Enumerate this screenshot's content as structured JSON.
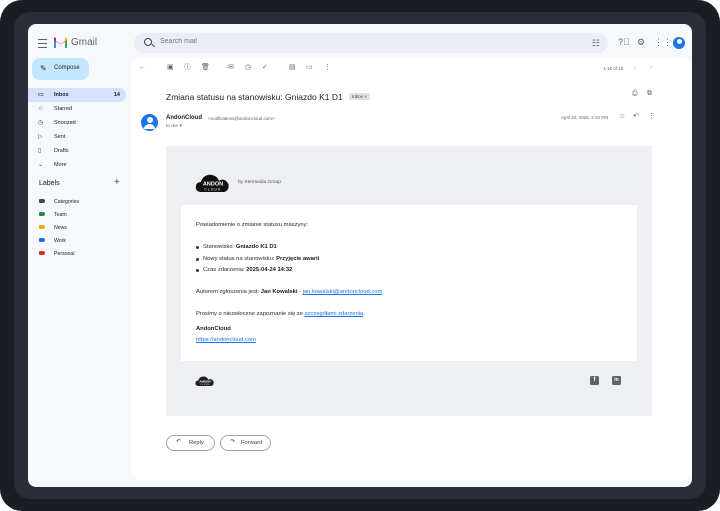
{
  "app": {
    "name": "Gmail"
  },
  "search": {
    "placeholder": "Search mail"
  },
  "compose": {
    "label": "Compose"
  },
  "nav": [
    {
      "label": "Inbox",
      "icon": "inbox-icon",
      "count": "14",
      "active": true
    },
    {
      "label": "Starred",
      "icon": "star-icon",
      "count": ""
    },
    {
      "label": "Snoozed",
      "icon": "clock-icon",
      "count": ""
    },
    {
      "label": "Sent",
      "icon": "send-icon",
      "count": ""
    },
    {
      "label": "Drafts",
      "icon": "draft-icon",
      "count": ""
    },
    {
      "label": "More",
      "icon": "chevron-down-icon",
      "count": ""
    }
  ],
  "labels": {
    "title": "Labels",
    "items": [
      {
        "name": "Categories",
        "color": "#444746"
      },
      {
        "name": "Team",
        "color": "#1e8e3e"
      },
      {
        "name": "News",
        "color": "#f9ab00"
      },
      {
        "name": "Work",
        "color": "#1a73e8"
      },
      {
        "name": "Personal",
        "color": "#d93025"
      }
    ]
  },
  "toolbar": {
    "page_count": "1-16 of 16"
  },
  "email": {
    "subject": "Zmiana statusu na stanowisku: Gniazdo K1 D1",
    "chip": "Inbox ×",
    "sender_name": "AndonCloud",
    "sender_email": "<notifications@andoncloud.com>",
    "to": "to me ▾",
    "date": "April 24, 2025, 2:32 PM",
    "brand": {
      "logo_top": "ANDON",
      "logo_bottom": "CLOUD",
      "by_line": "by Stermedia Group"
    },
    "body": {
      "intro": "Powiadomienie o zmianie statusu maszyny:",
      "b1_label": "Stanowisko: ",
      "b1_value": "Gniazdo K1 D1",
      "b2_label": "Nowy status na stanowisku: ",
      "b2_value": "Przyjęcie awarii",
      "b3_label": "Czas zdarzenia: ",
      "b3_value": "2025-04-24 14:32",
      "author_prefix": "Autorem zgłoszenia jest: ",
      "author_name": "Jan Kowalski",
      "author_sep": " - ",
      "author_email": "jan.kowalski@andoncloud.com",
      "request_prefix": "Prosimy o niezwłoczne zapoznanie się ze ",
      "request_link": "szczegółami zdarzenia",
      "request_suffix": ".",
      "signature": "AndonCloud",
      "site": "https://andoncloud.com"
    },
    "social": {
      "facebook": "f",
      "linkedin": "in"
    }
  },
  "actions": {
    "reply": "Reply",
    "forward": "Forward"
  },
  "colors": {
    "accent": "#1a73e8",
    "compose_bg": "#c2e7ff",
    "active_nav": "#d3e3fd",
    "search_bg": "#e9eef6"
  }
}
